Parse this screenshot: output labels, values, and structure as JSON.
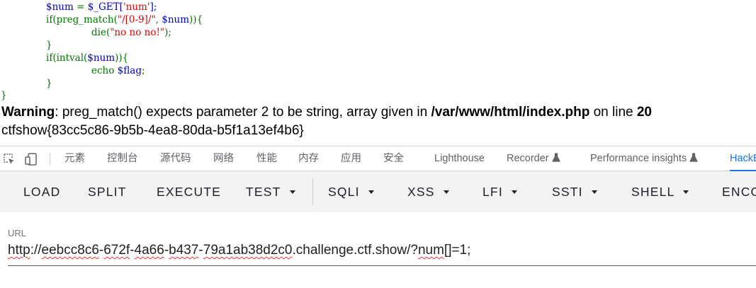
{
  "source_code": {
    "line1": {
      "var": "$num",
      "eq": " = ",
      "rhs": "$_GET[",
      "key": "'num'",
      "end": "];"
    },
    "line2": {
      "kw": "if(preg_match(",
      "pattern": "\"/[0-9]/\"",
      "comma": ", ",
      "var": "$num",
      "end": ")){"
    },
    "line3": {
      "kw": "die(",
      "str": "\"no no no!\"",
      "end": ");"
    },
    "line4": "}",
    "line5": {
      "kw": "if(intval(",
      "var": "$num",
      "end": ")){"
    },
    "line6": {
      "kw": "echo ",
      "var": "$flag",
      "end": ";"
    },
    "line7": "}",
    "line8": "}"
  },
  "php_output": {
    "warning_label": "Warning",
    "warning_text": ": preg_match() expects parameter 2 to be string, array given in ",
    "warning_file": "/var/www/html/index.php",
    "warning_online": " on line ",
    "warning_line": "20",
    "flag": "ctfshow{83cc5c86-9b5b-4ea8-80da-b5f1a13ef4b6}"
  },
  "devtools": {
    "tabs": [
      "元素",
      "控制台",
      "源代码",
      "网络",
      "性能",
      "内存",
      "应用",
      "安全",
      "Lighthouse",
      "Recorder",
      "Performance insights",
      "HackB"
    ],
    "active_tab": "HackB",
    "accent_color": "#1a73e8",
    "icons": [
      "inspect-element-icon",
      "device-toolbar-icon",
      "flask-icon"
    ]
  },
  "hackbar": {
    "buttons": [
      "LOAD",
      "SPLIT",
      "EXECUTE"
    ],
    "dropdowns": [
      "TEST",
      "SQLI",
      "XSS",
      "LFI",
      "SSTI",
      "SHELL"
    ],
    "cut_button": "ENCO"
  },
  "url_field": {
    "label": "URL",
    "value": "http://eebcc8c6-672f-4a66-b437-79a1ab38d2c0.challenge.ctf.show/?num[]=1;",
    "parts": {
      "p1": "http",
      "p2": "://",
      "p3": "eebcc8c6",
      "p4": "-",
      "p5": "672f",
      "p6": "-",
      "p7": "4a66",
      "p8": "-",
      "p9": "b437",
      "p10": "-",
      "p11": "79a1ab38d2c0",
      "p12": ".challenge.ctf.show/?",
      "p13": "num",
      "p14": "[]=1;"
    }
  }
}
